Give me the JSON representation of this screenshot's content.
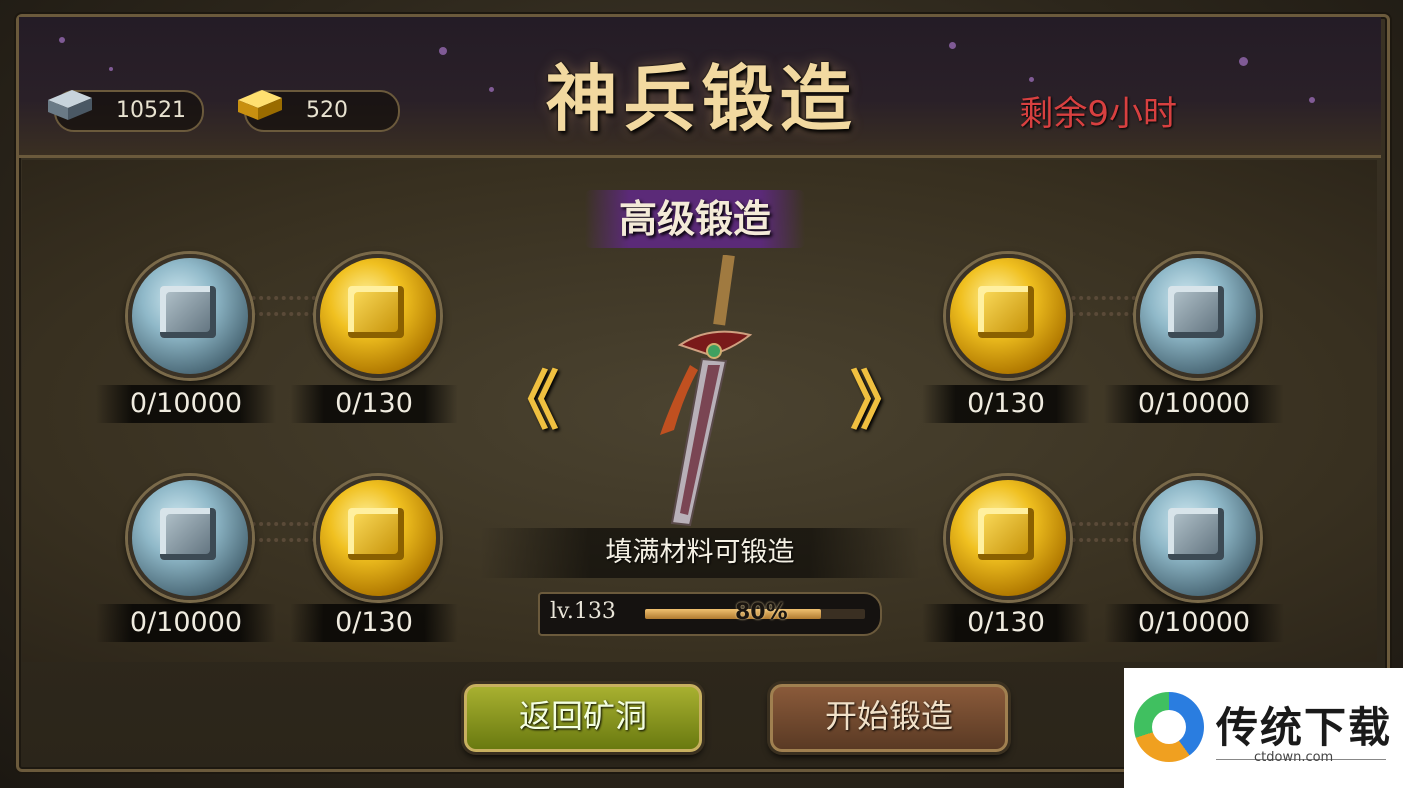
{
  "header": {
    "title": "神兵锻造",
    "remaining": "剩余9小时",
    "iron_amount": "10521",
    "gold_amount": "520"
  },
  "forge": {
    "tier_label": "高级锻造",
    "prev_arrow": "《",
    "next_arrow": "》",
    "hint": "填满材料可锻造",
    "level": "lv.133",
    "progress_label": "80%",
    "progress_value": 0.8
  },
  "materials": {
    "left_top": {
      "iron": "0/10000",
      "gold": "0/130"
    },
    "left_bottom": {
      "iron": "0/10000",
      "gold": "0/130"
    },
    "right_top": {
      "gold": "0/130",
      "iron": "0/10000"
    },
    "right_bottom": {
      "gold": "0/130",
      "iron": "0/10000"
    }
  },
  "buttons": {
    "back": "返回矿洞",
    "start": "开始锻造"
  },
  "watermark": {
    "name": "传统下载",
    "site": "ctdown.com"
  }
}
